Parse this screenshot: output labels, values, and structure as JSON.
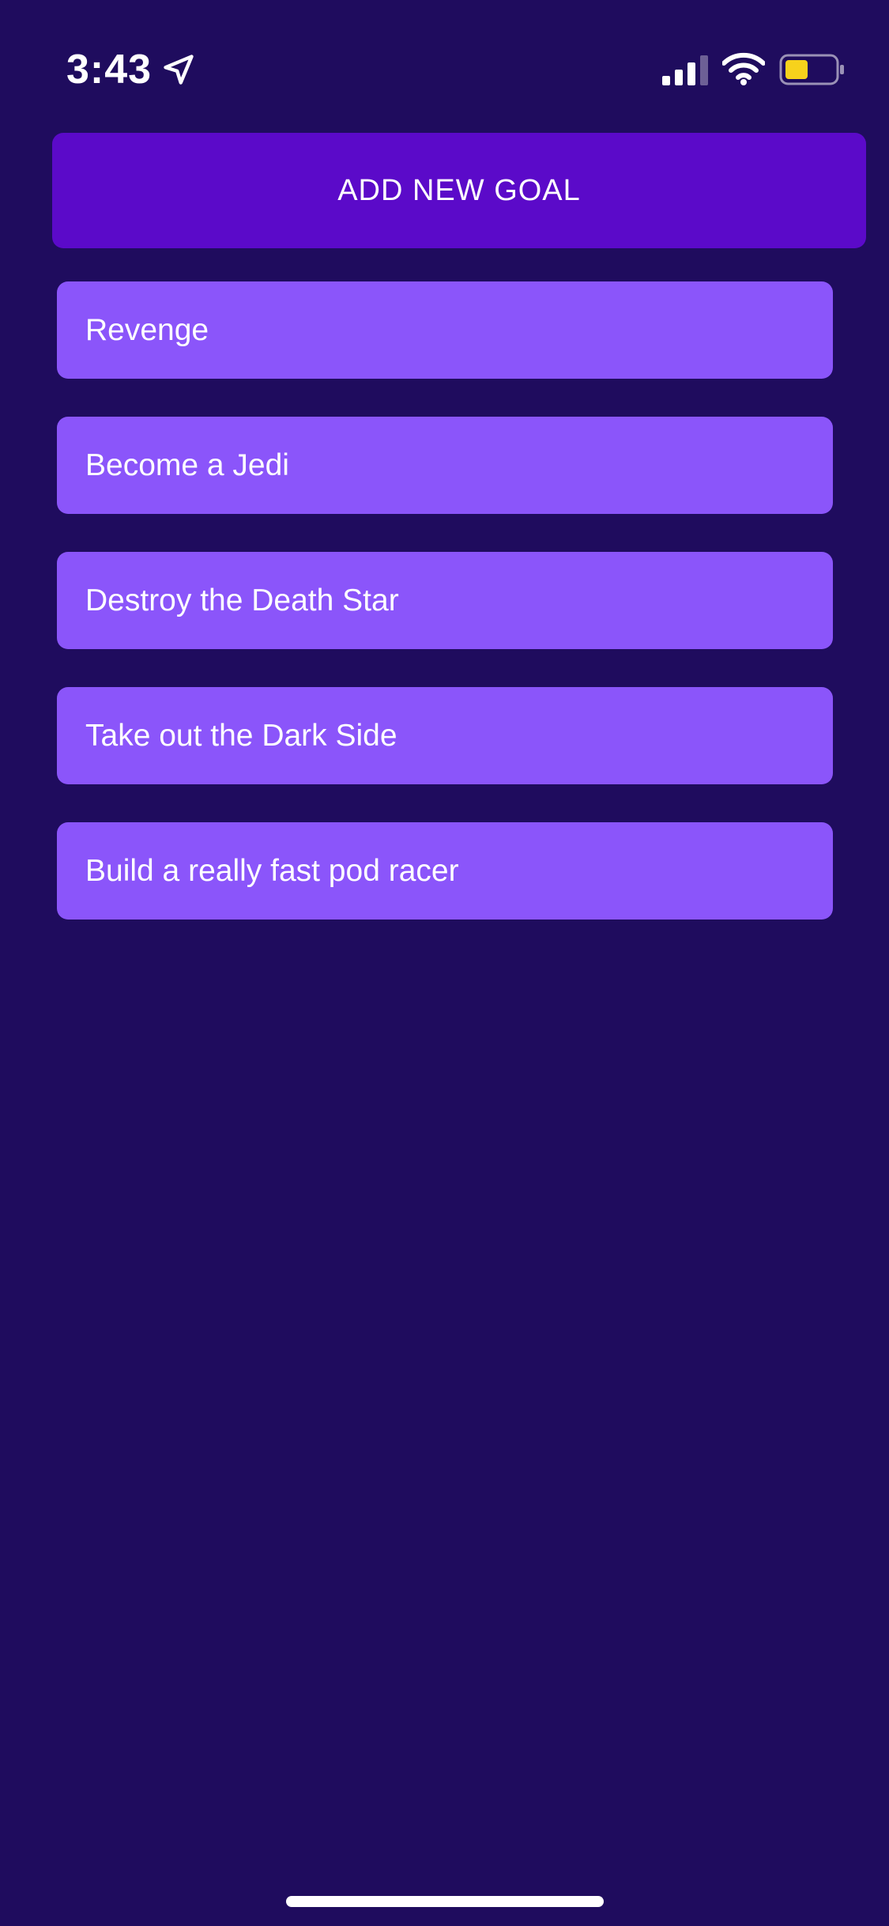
{
  "status_bar": {
    "time": "3:43",
    "icons": [
      "location-arrow-icon",
      "cellular-signal-icon",
      "wifi-icon",
      "battery-icon"
    ]
  },
  "add_goal_button": {
    "label": "ADD NEW GOAL"
  },
  "goals": [
    {
      "text": "Revenge"
    },
    {
      "text": "Become a Jedi"
    },
    {
      "text": "Destroy the Death Star"
    },
    {
      "text": "Take out the Dark Side"
    },
    {
      "text": "Build a really fast pod racer"
    }
  ],
  "colors": {
    "background": "#1f0c5e",
    "button": "#5b0ac9",
    "goal_item": "#8b55fa",
    "battery_fill": "#f7d21c"
  }
}
